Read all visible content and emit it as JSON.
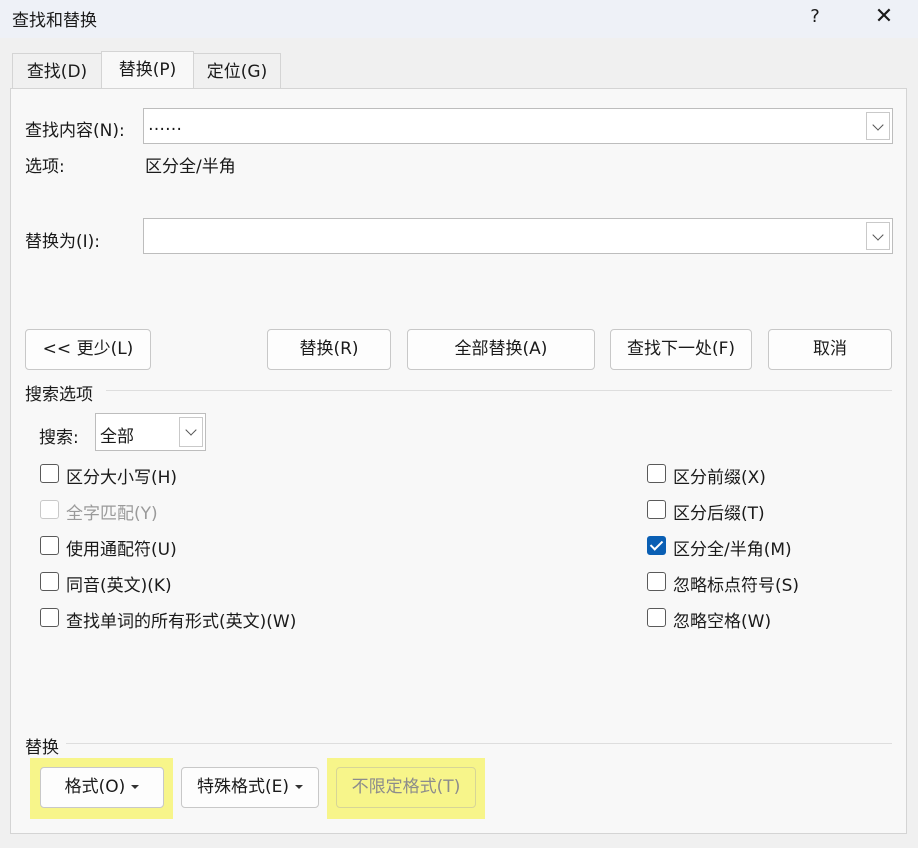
{
  "window": {
    "title": "查找和替换",
    "help": "?",
    "close": "✕"
  },
  "tabs": [
    {
      "label": "查找(D)"
    },
    {
      "label": "替换(P)"
    },
    {
      "label": "定位(G)"
    }
  ],
  "find": {
    "label": "查找内容(N):",
    "value": "……"
  },
  "options": {
    "label": "选项:",
    "value": "区分全/半角"
  },
  "replace": {
    "label": "替换为(I):",
    "value": ""
  },
  "buttons": {
    "less": "<< 更少(L)",
    "replace": "替换(R)",
    "replace_all": "全部替换(A)",
    "find_next": "查找下一处(F)",
    "cancel": "取消"
  },
  "search_options": {
    "section_label": "搜索选项",
    "search_label": "搜索:",
    "search_value": "全部"
  },
  "checkboxes_left": [
    {
      "label": "区分大小写(H)",
      "checked": false,
      "disabled": false
    },
    {
      "label": "全字匹配(Y)",
      "checked": false,
      "disabled": true
    },
    {
      "label": "使用通配符(U)",
      "checked": false,
      "disabled": false
    },
    {
      "label": "同音(英文)(K)",
      "checked": false,
      "disabled": false
    },
    {
      "label": "查找单词的所有形式(英文)(W)",
      "checked": false,
      "disabled": false
    }
  ],
  "checkboxes_right": [
    {
      "label": "区分前缀(X)",
      "checked": false,
      "disabled": false
    },
    {
      "label": "区分后缀(T)",
      "checked": false,
      "disabled": false
    },
    {
      "label": "区分全/半角(M)",
      "checked": true,
      "disabled": false
    },
    {
      "label": "忽略标点符号(S)",
      "checked": false,
      "disabled": false
    },
    {
      "label": "忽略空格(W)",
      "checked": false,
      "disabled": false
    }
  ],
  "replace_section": {
    "label": "替换",
    "format": "格式(O)",
    "special": "特殊格式(E)",
    "no_format": "不限定格式(T)"
  },
  "colors": {
    "accent": "#0a5fb4",
    "highlight": "#f7f58a"
  }
}
